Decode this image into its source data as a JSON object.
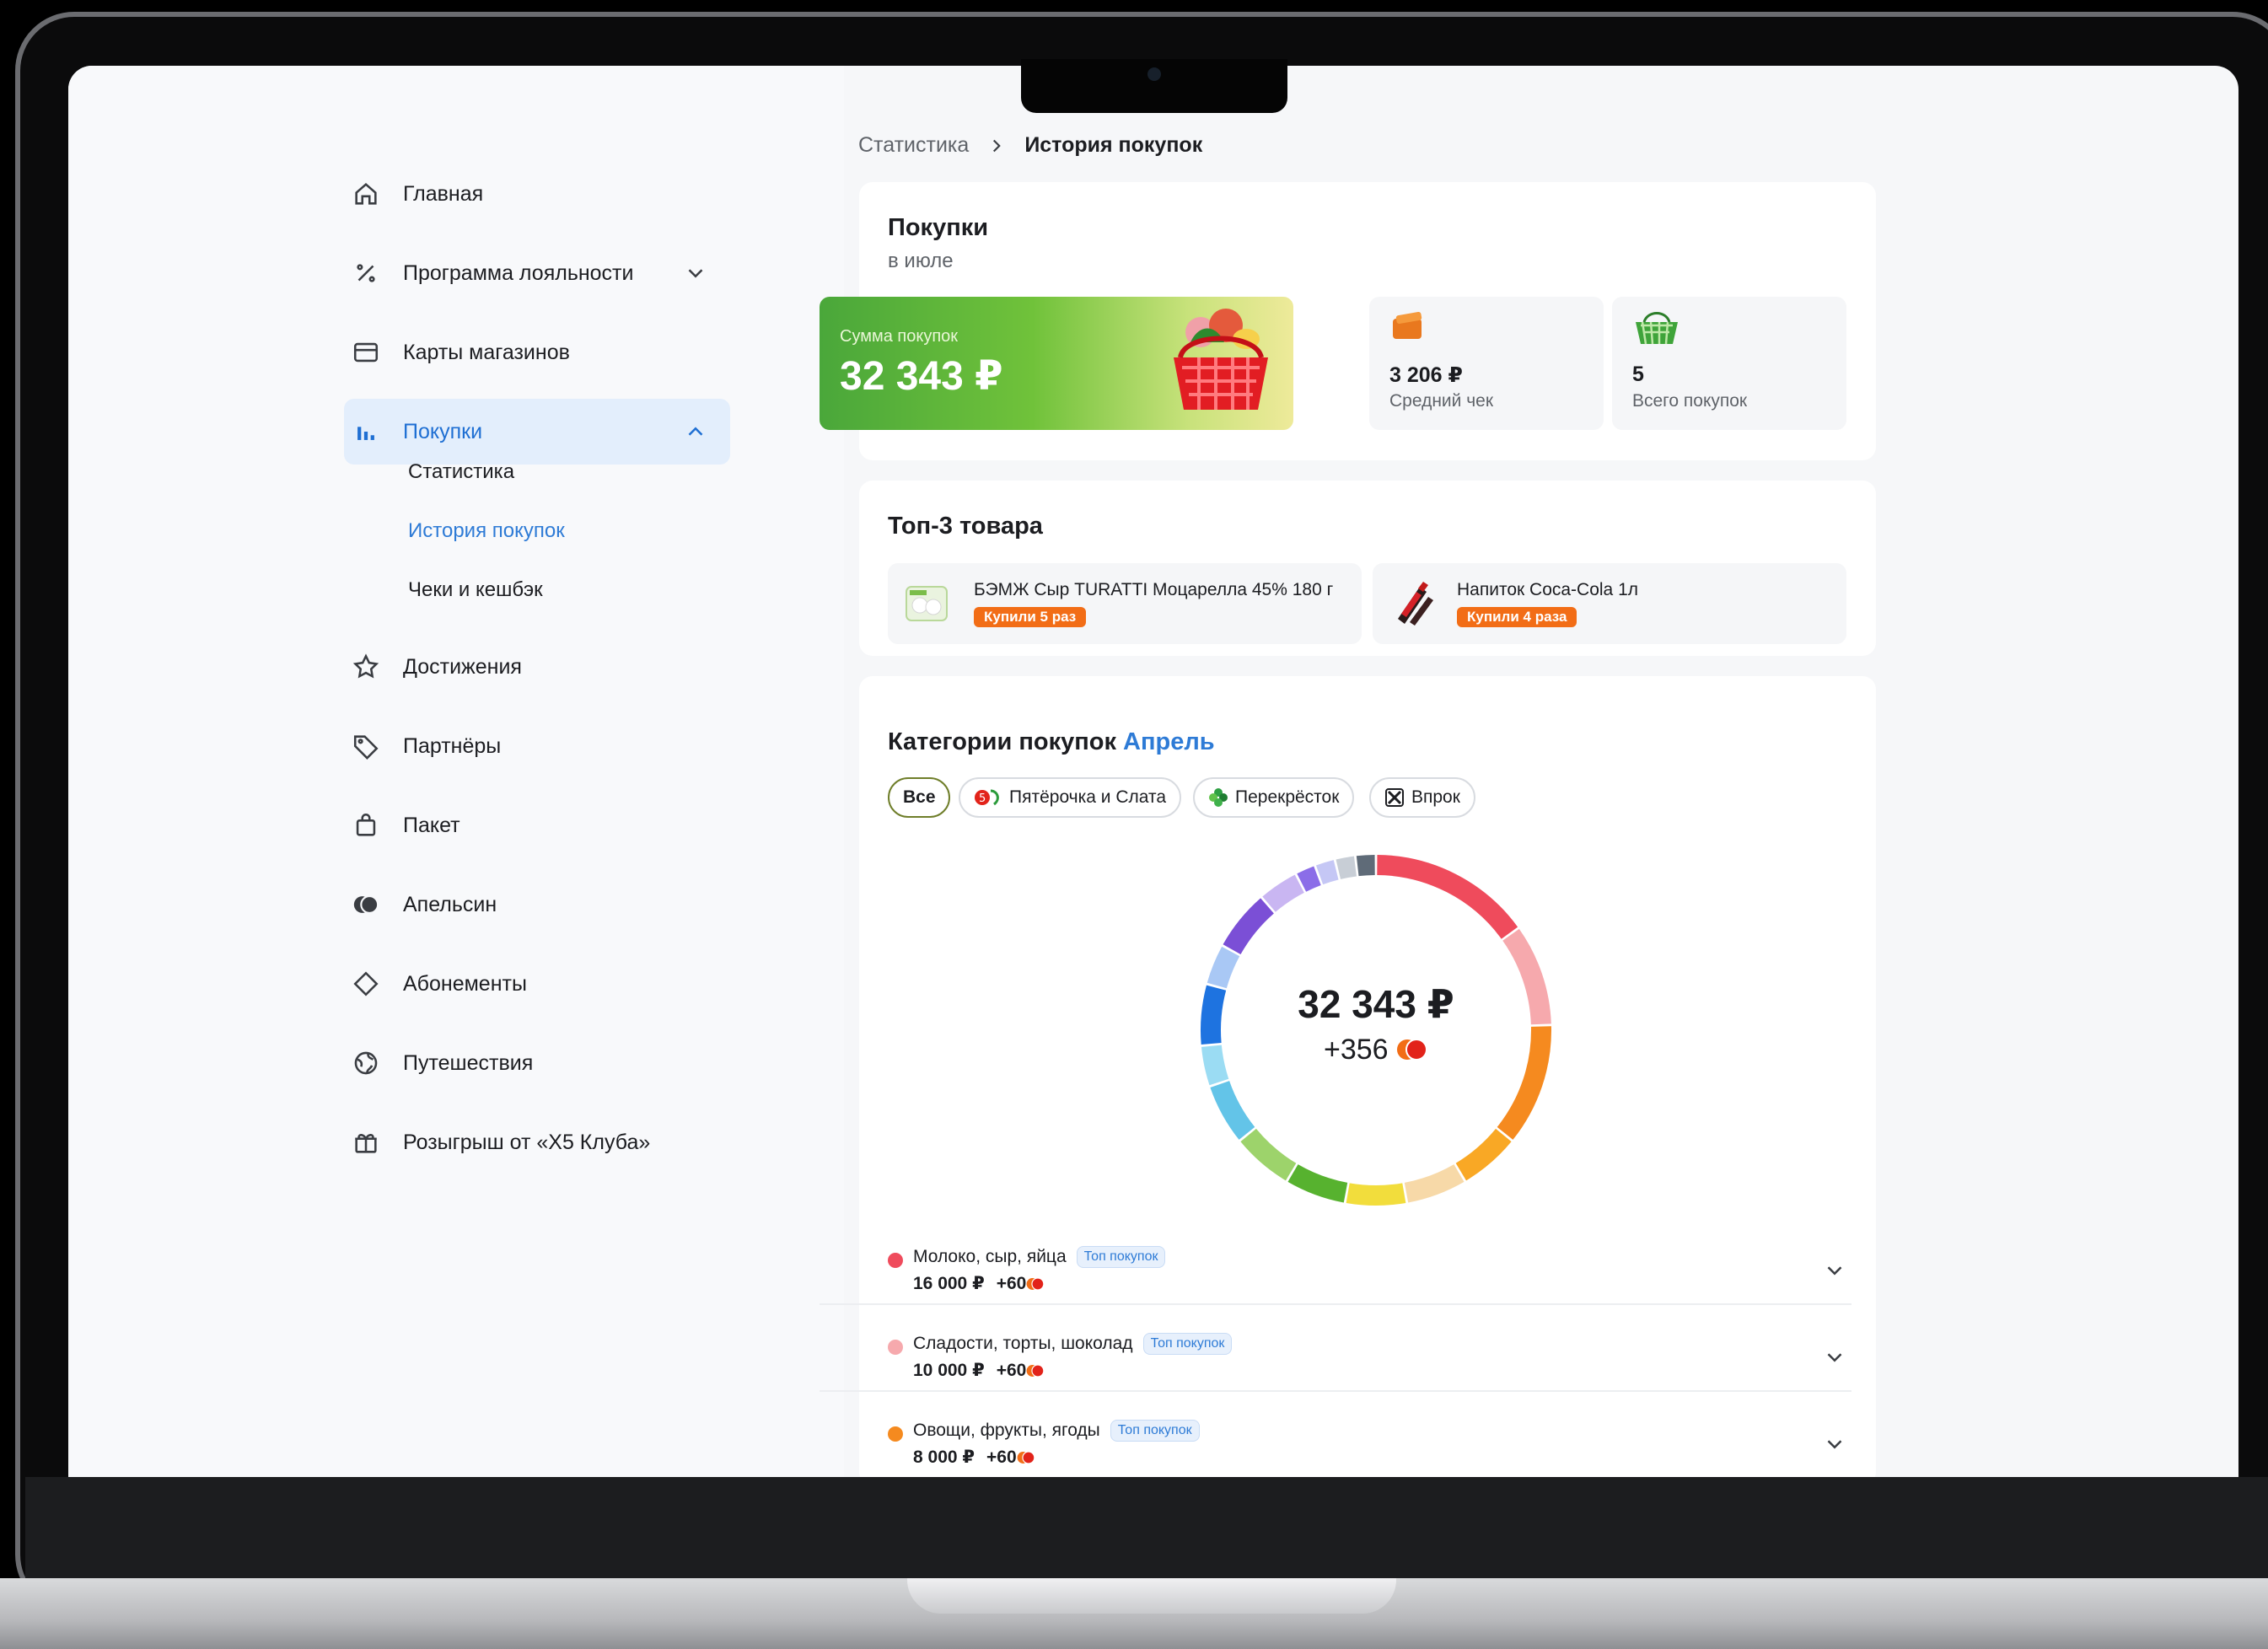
{
  "sidebar": {
    "items": [
      {
        "label": "Главная",
        "icon": "home-icon"
      },
      {
        "label": "Программа лояльности",
        "icon": "percent-icon"
      },
      {
        "label": "Карты магазинов",
        "icon": "card-icon"
      },
      {
        "label": "Покупки",
        "icon": "bar-chart-icon"
      },
      {
        "label": "Достижения",
        "icon": "star-icon"
      },
      {
        "label": "Партнёры",
        "icon": "tag-icon"
      },
      {
        "label": "Пакет",
        "icon": "bag-icon"
      },
      {
        "label": "Апельсин",
        "icon": "orange-icon"
      },
      {
        "label": "Абонементы",
        "icon": "diamond-icon"
      },
      {
        "label": "Путешествия",
        "icon": "globe-icon"
      },
      {
        "label": "Розыгрыш от «Х5 Клуба»",
        "icon": "gift-icon"
      }
    ],
    "subitems": [
      "Статистика",
      "История покупок",
      "Чеки и кешбэк"
    ]
  },
  "breadcrumb": {
    "parent": "Статистика",
    "current": "История покупок"
  },
  "purchases": {
    "title": "Покупки",
    "period": "в июле",
    "sum_label": "Сумма покупок",
    "sum_value": "32 343 ₽",
    "avg_value": "3 206 ₽",
    "avg_label": "Средний чек",
    "count_value": "5",
    "count_label": "Всего покупок"
  },
  "top3": {
    "title": "Топ-3 товара",
    "items": [
      {
        "name": "БЭМЖ Сыр  TURATTI Моцарелла 45% 180 г",
        "badge": "Купили 5 раз"
      },
      {
        "name": "Напиток Coca-Cola 1л",
        "badge": "Купили 4 раза"
      }
    ]
  },
  "categories": {
    "title": "Категории покупок",
    "month": "Апрель",
    "filters": [
      "Все",
      "Пятёрочка и Слата",
      "Перекрёсток",
      "Впрок"
    ],
    "total": "32 343 ₽",
    "bonus": "+356",
    "rows": [
      {
        "name": "Молоко, сыр, яйца",
        "tag": "Топ покупок",
        "amount": "16 000 ₽",
        "bonus": "+60",
        "color": "#ef4b5c"
      },
      {
        "name": "Сладости, торты, шоколад",
        "tag": "Топ покупок",
        "amount": "10 000 ₽",
        "bonus": "+60",
        "color": "#f6a9ad"
      },
      {
        "name": "Овощи, фрукты, ягоды",
        "tag": "Топ покупок",
        "amount": "8 000 ₽",
        "bonus": "+60",
        "color": "#f58a1f"
      }
    ]
  },
  "chart_data": {
    "type": "pie",
    "style": "donut",
    "segment_colors": [
      "#ef4b5c",
      "#f6a9ad",
      "#f58a1f",
      "#f9a825",
      "#f7d9a8",
      "#f2dd3c",
      "#57b22f",
      "#9dd36b",
      "#63c4e8",
      "#9bdcf3",
      "#1e73e0",
      "#a9c8f5",
      "#7b4fd6",
      "#c9b6f2",
      "#8b6de8",
      "#c5c7f5",
      "#c8ced6",
      "#5f6b78"
    ]
  }
}
